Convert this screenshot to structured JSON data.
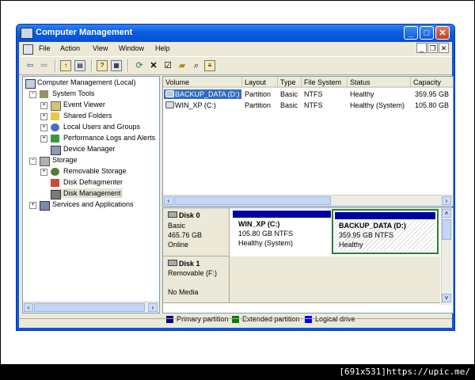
{
  "window": {
    "title": "Computer Management"
  },
  "menubar": {
    "items": [
      "File",
      "Action",
      "View",
      "Window",
      "Help"
    ]
  },
  "tree": {
    "nodes": [
      {
        "label": "Computer Management (Local)",
        "icon": "computer-icon"
      },
      {
        "label": "System Tools",
        "icon": "tools-icon"
      },
      {
        "label": "Event Viewer",
        "icon": "event-viewer-icon"
      },
      {
        "label": "Shared Folders",
        "icon": "folder-icon"
      },
      {
        "label": "Local Users and Groups",
        "icon": "users-icon"
      },
      {
        "label": "Performance Logs and Alerts",
        "icon": "performance-icon"
      },
      {
        "label": "Device Manager",
        "icon": "device-manager-icon"
      },
      {
        "label": "Storage",
        "icon": "storage-icon"
      },
      {
        "label": "Removable Storage",
        "icon": "removable-storage-icon"
      },
      {
        "label": "Disk Defragmenter",
        "icon": "defrag-icon"
      },
      {
        "label": "Disk Management",
        "icon": "disk-management-icon"
      },
      {
        "label": "Services and Applications",
        "icon": "services-icon"
      }
    ]
  },
  "volumes": {
    "columns": [
      "Volume",
      "Layout",
      "Type",
      "File System",
      "Status",
      "Capacity"
    ],
    "rows": [
      [
        "BACKUP_DATA (D:)",
        "Partition",
        "Basic",
        "NTFS",
        "Healthy",
        "359.95 GB"
      ],
      [
        "WIN_XP (C:)",
        "Partition",
        "Basic",
        "NTFS",
        "Healthy (System)",
        "105.80 GB"
      ]
    ]
  },
  "disks": {
    "disk0": {
      "name": "Disk 0",
      "type": "Basic",
      "size": "465.76 GB",
      "state": "Online",
      "partitions": [
        {
          "name": "WIN_XP  (C:)",
          "size": "105.80 GB NTFS",
          "status": "Healthy (System)"
        },
        {
          "name": "BACKUP_DATA  (D:)",
          "size": "359.95 GB NTFS",
          "status": "Healthy"
        }
      ]
    },
    "disk1": {
      "name": "Disk 1",
      "type": "Removable (F:)",
      "media": "No Media"
    }
  },
  "legend": {
    "items": [
      {
        "label": "Primary partition",
        "color": "#000080"
      },
      {
        "label": "Extended partition",
        "color": "#008000"
      },
      {
        "label": "Logical drive",
        "color": "#0000ff"
      }
    ]
  },
  "footer": {
    "text": "[691x531]https://upic.me/"
  }
}
